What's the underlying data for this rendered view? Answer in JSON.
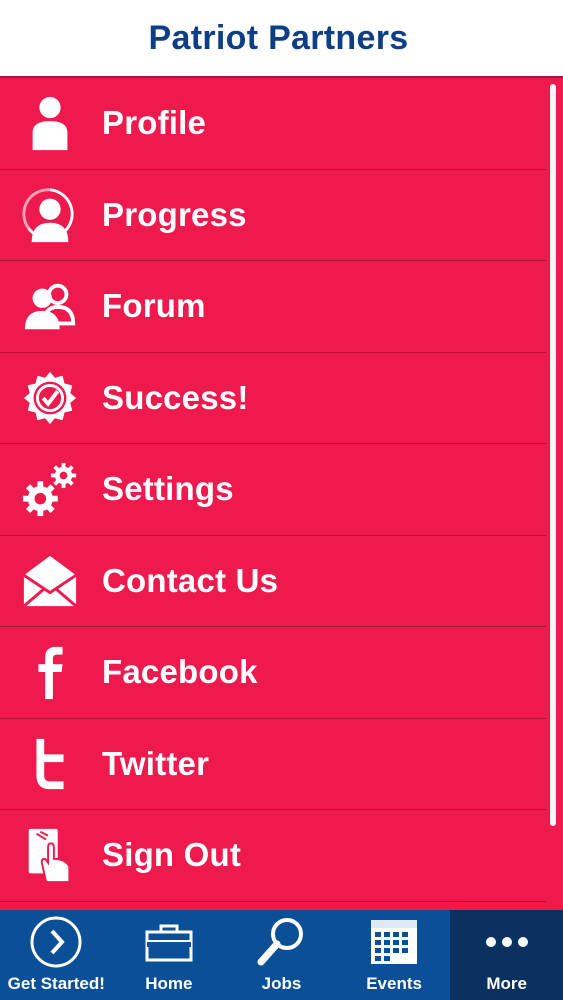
{
  "header": {
    "title": "Patriot Partners"
  },
  "menu": {
    "items": [
      {
        "label": "Profile",
        "icon": "person-icon"
      },
      {
        "label": "Progress",
        "icon": "progress-icon"
      },
      {
        "label": "Forum",
        "icon": "group-icon"
      },
      {
        "label": "Success!",
        "icon": "badge-check-icon"
      },
      {
        "label": "Settings",
        "icon": "gears-icon"
      },
      {
        "label": "Contact Us",
        "icon": "envelope-icon"
      },
      {
        "label": "Facebook",
        "icon": "facebook-icon"
      },
      {
        "label": "Twitter",
        "icon": "twitter-icon"
      },
      {
        "label": "Sign Out",
        "icon": "sign-out-icon"
      }
    ]
  },
  "tabbar": {
    "tabs": [
      {
        "label": "Get Started!",
        "icon": "play-circle-icon"
      },
      {
        "label": "Home",
        "icon": "briefcase-icon"
      },
      {
        "label": "Jobs",
        "icon": "magnifier-icon"
      },
      {
        "label": "Events",
        "icon": "calendar-icon"
      },
      {
        "label": "More",
        "icon": "more-dots-icon"
      }
    ],
    "active": "More"
  },
  "colors": {
    "header_bg": "#ffffff",
    "title": "#0e3f86",
    "menu_bg": "#ee1a4e",
    "tabbar_bg": "#0b4f96",
    "tab_active_bg": "#0a3160"
  }
}
